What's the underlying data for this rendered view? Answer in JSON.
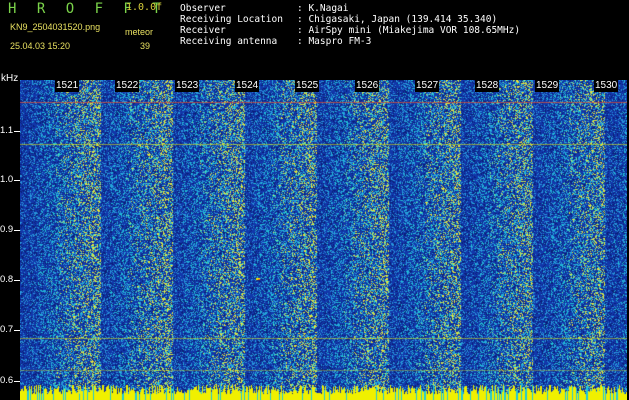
{
  "header": {
    "brand": "H R O F F T",
    "version": "1.0.0f",
    "file_name": "KN9_2504031520.png",
    "timestamp": "25.04.03 15:20",
    "meteor_label": "meteor",
    "meteor_count": "39"
  },
  "station": {
    "rows": [
      {
        "key": "Observer",
        "value": ": K.Nagai"
      },
      {
        "key": "Receiving Location",
        "value": ": Chigasaki, Japan (139.414 35.340)"
      },
      {
        "key": "Receiver",
        "value": ": AirSpy mini (Miakejima VOR 108.65MHz)"
      },
      {
        "key": "Receiving antenna",
        "value": ": Maspro FM-3"
      }
    ]
  },
  "axis": {
    "unit": "kHz",
    "y_ticks": [
      "1.1",
      "1.0",
      "0.9",
      "0.8",
      "0.7",
      "0.6"
    ],
    "minute_labels": [
      "1521",
      "1522",
      "1523",
      "1524",
      "1525",
      "1526",
      "1527",
      "1528",
      "1529",
      "1530"
    ]
  },
  "colors": {
    "background": "#000000",
    "waterfall_base": "#1540a8",
    "noise_cyan": "#1ec8d8",
    "signal_yellow": "#f0f000",
    "brand_green": "#7bd44a"
  }
}
